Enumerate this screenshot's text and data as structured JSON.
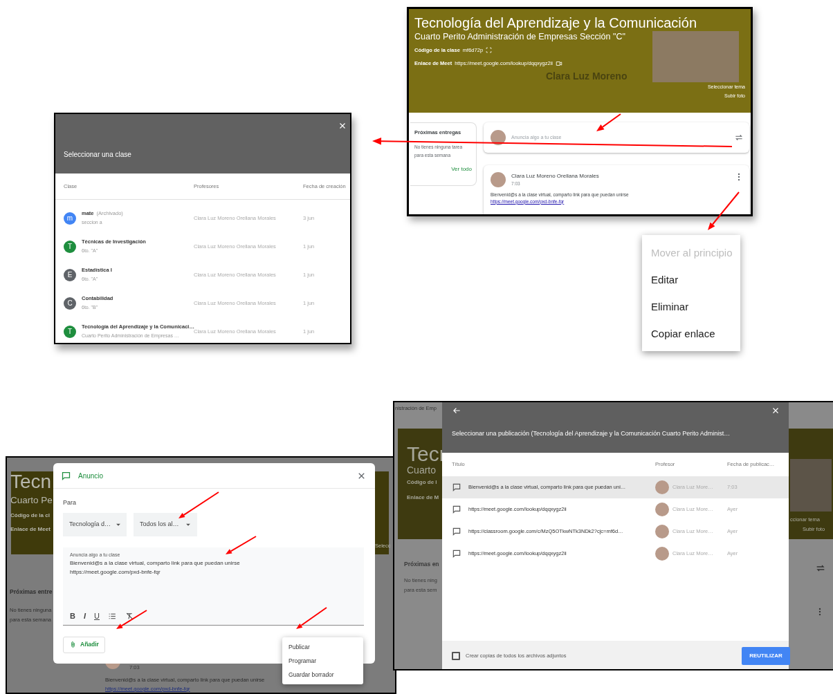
{
  "class_banner": {
    "title": "Tecnología del Aprendizaje y la Comunicación",
    "subtitle": "Cuarto Perito Administración de Empresas Sección \"C\"",
    "code_label": "Código de la clase",
    "code": "mf6d72p",
    "meet_label": "Enlace de Meet",
    "meet_link": "https://meet.google.com/lookup/dqqxygz2ii",
    "banner_name": "Clara Luz Moreno",
    "links": [
      "Seleccionar tema",
      "Subir foto"
    ]
  },
  "upcoming": {
    "title": "Próximas entregas",
    "text": "No tienes ninguna tarea para esta semana",
    "link": "Ver todo"
  },
  "composer": {
    "placeholder": "Anuncia algo a tu clase"
  },
  "post": {
    "author": "Clara Luz Moreno Orellana Morales",
    "time": "7:03",
    "text": "Bienvenid@s a la clase virtual, comparto link para que puedan unirse",
    "link": "https://meet.google.com/pxd-bnfe-fqr"
  },
  "class_picker": {
    "title": "Seleccionar una clase",
    "columns": [
      "Clase",
      "Profesores",
      "Fecha de creación"
    ],
    "rows": [
      {
        "initial": "m",
        "color": "#4285f4",
        "name": "mate",
        "status": "(Archivado)",
        "section": "seccion a",
        "teacher": "Clara Luz Moreno Orellana Morales",
        "date": "3 jun"
      },
      {
        "initial": "T",
        "color": "#1e8e3e",
        "name": "Técnicas de Investigación",
        "section": "6to. \"A\"",
        "teacher": "Clara Luz Moreno Orellana Morales",
        "date": "1 jun"
      },
      {
        "initial": "E",
        "color": "#5f6368",
        "name": "Estadística I",
        "section": "6to. \"A\"",
        "teacher": "Clara Luz Moreno Orellana Morales",
        "date": "1 jun"
      },
      {
        "initial": "C",
        "color": "#5f6368",
        "name": "Contabilidad",
        "section": "6to. \"B\"",
        "teacher": "Clara Luz Moreno Orellana Morales",
        "date": "1 jun"
      },
      {
        "initial": "T",
        "color": "#1e8e3e",
        "name": "Tecnología del Aprendizaje y la Comunicaci…",
        "section": "Cuarto Perito Administración de Empresas …",
        "teacher": "Clara Luz Moreno Orellana Morales",
        "date": "1 jun"
      }
    ]
  },
  "post_menu": [
    {
      "label": "Mover al principio",
      "disabled": true
    },
    {
      "label": "Editar",
      "disabled": false
    },
    {
      "label": "Eliminar",
      "disabled": false
    },
    {
      "label": "Copiar enlace",
      "disabled": false
    }
  ],
  "announcement_dialog": {
    "backdrop": {
      "banner": [
        "Tecn",
        "Cuarto Pe",
        "Código de la cl",
        "Enlace de Meet"
      ],
      "banner_right": [
        "Selecc"
      ],
      "side": [
        "Próximas entre",
        "No tienes ninguna",
        "para esta semana"
      ],
      "post_time": "7:03",
      "post_text": "Bienvenid@s a la clase virtual, comparto link para que puedan unirse",
      "post_link": "https://meet.google.com/pxd-bnfe-fqr"
    },
    "title": "Anuncio",
    "for_label": "Para",
    "selects": [
      "Tecnología d…",
      "Todos los al…"
    ],
    "field_label": "Anuncia algo a tu clase",
    "body": [
      "Bienvenid@s a la clase virtual, comparto link para que puedan unirse",
      "https://meet.google.com/pxd-bnfe-fqr"
    ],
    "format_buttons": [
      "B",
      "I",
      "U"
    ],
    "add_button": "Añadir",
    "post_options": [
      "Publicar",
      "Programar",
      "Guardar borrador"
    ]
  },
  "reuse_dialog": {
    "backdrop": {
      "top": "nistración de Emp",
      "banner": [
        "Tecn",
        "Cuarto",
        "Código de l",
        "Enlace de M"
      ],
      "banner_right": [
        "ccionar tema",
        "Subir foto"
      ],
      "side": [
        "Próximas en",
        "No tienes ning",
        "para esta sem"
      ]
    },
    "title": "Seleccionar una publicación (Tecnología del Aprendizaje y la Comunicación Cuarto Perito Administ…",
    "columns": [
      "Título",
      "Profesor",
      "Fecha de publicac…"
    ],
    "rows": [
      {
        "title": "Bienvenid@s a la clase virtual, comparto link para que puedan uni…",
        "teacher": "Clara Luz More…",
        "date": "7:03",
        "selected": true
      },
      {
        "title": "https://meet.google.com/lookup/dqqxygz2ii",
        "teacher": "Clara Luz More…",
        "date": "Ayer",
        "selected": false
      },
      {
        "title": "https://classroom.google.com/c/MzQ5OTkwNTk3NDk2?cjc=mf6d…",
        "teacher": "Clara Luz More…",
        "date": "Ayer",
        "selected": false
      },
      {
        "title": "https://meet.google.com/lookup/dqqxygz2ii",
        "teacher": "Clara Luz More…",
        "date": "Ayer",
        "selected": false
      }
    ],
    "copy_attachments": {
      "label": "Crear copias de todos los archivos adjuntos",
      "checked": false
    },
    "button": "REUTILIZAR"
  }
}
